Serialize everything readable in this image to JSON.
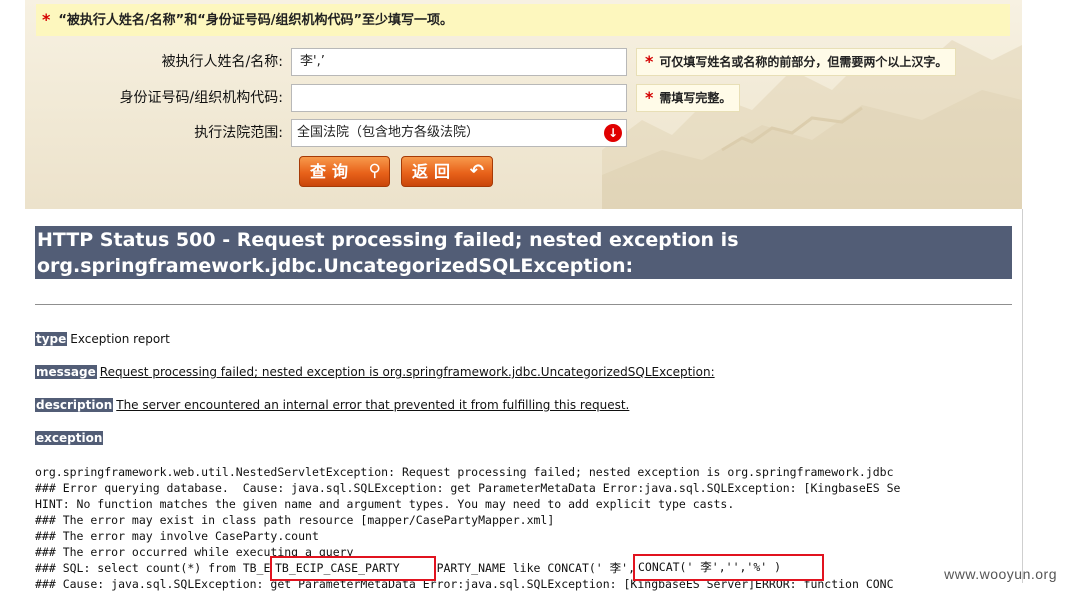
{
  "form": {
    "notice": "“被执行人姓名/名称”和“身份证号码/组织机构代码”至少填写一项。",
    "name_label": "被执行人姓名/名称:",
    "name_value": "李',’",
    "name_hint": "可仅填写姓名或名称的前部分，但需要两个以上汉字。",
    "id_label": "身份证号码/组织机构代码:",
    "id_value": "",
    "id_hint": "需填写完整。",
    "court_label": "执行法院范围:",
    "court_value": "全国法院（包含地方各级法院）",
    "search_button": "查询",
    "back_button": "返回"
  },
  "error": {
    "title_line1": "HTTP Status 500 - Request processing failed; nested exception is",
    "title_line2": "org.springframework.jdbc.UncategorizedSQLException:",
    "type_tag": "type",
    "type_text": "Exception report",
    "message_tag": "message",
    "message_text": "Request processing failed; nested exception is org.springframework.jdbc.UncategorizedSQLException:",
    "description_tag": "description",
    "description_text": "The server encountered an internal error that prevented it from fulfilling this request.",
    "exception_tag": "exception",
    "trace": [
      "org.springframework.web.util.NestedServletException: Request processing failed; nested exception is org.springframework.jdbc",
      "### Error querying database.  Cause: java.sql.SQLException: get ParameterMetaData Error:java.sql.SQLException: [KingbaseES Se",
      "HINT: No function matches the given name and argument types. You may need to add explicit type casts.",
      "### The error may exist in class path resource [mapper/CasePartyMapper.xml]",
      "### The error may involve CaseParty.count",
      "### The error occurred while executing a query",
      "### SQL: select count(*) from TB_ECIP_CASE_PARTY   WHERE CPARTY_NAME like CONCAT(' 李','','%' )",
      "### Cause: java.sql.SQLException: get ParameterMetaData Error:java.sql.SQLException: [KingbaseES Server]ERROR: function CONC"
    ],
    "highlight_table": "TB_ECIP_CASE_PARTY",
    "highlight_concat": "CONCAT(' 李','','%' )"
  },
  "watermark": "www.wooyun.org",
  "colors": {
    "error_header_bg": "#525d76",
    "button_orange": "#e8621a",
    "required_star": "#d40000",
    "highlight_box": "#e1131f"
  }
}
